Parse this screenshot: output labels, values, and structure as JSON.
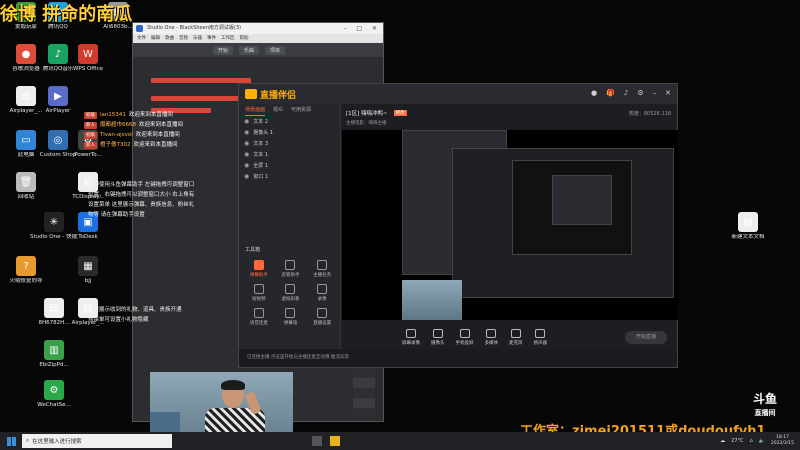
{
  "overlay": {
    "title": "徐博 拼命的南瓜"
  },
  "desktop_icons": [
    {
      "label": "爱毅玩家",
      "color": "#3a9b3a",
      "glyph": "◆"
    },
    {
      "label": "腾讯QQ",
      "color": "#1a9fe0",
      "glyph": "Q"
    },
    {
      "label": "Ali6803b...",
      "color": "#999999",
      "glyph": "▦"
    },
    {
      "label": "谷歌浏览器",
      "color": "#dd4b39",
      "glyph": "●"
    },
    {
      "label": "腾讯QQ音乐",
      "color": "#1aa260",
      "glyph": "♪"
    },
    {
      "label": "WPS Office",
      "color": "#d03a2f",
      "glyph": "W"
    },
    {
      "label": "Airplayer_...",
      "color": "#eeeeee",
      "glyph": "▤"
    },
    {
      "label": "AirPlayer",
      "color": "#5b6cc8",
      "glyph": "▶"
    },
    {
      "label": "此电脑",
      "color": "#2f86d6",
      "glyph": "▭"
    },
    {
      "label": "Custom Shop",
      "color": "#2f6fb0",
      "glyph": "◎"
    },
    {
      "label": "PowerTo...",
      "color": "#444444",
      "glyph": "⚙"
    },
    {
      "label": "回收站",
      "color": "#bbbbbb",
      "glyph": "🗑"
    },
    {
      "label": "TCDisplay...",
      "color": "#eeeeee",
      "glyph": "▤"
    },
    {
      "label": "Studio One - 快捷方式",
      "color": "#222222",
      "glyph": "✳"
    },
    {
      "label": "ToDesk",
      "color": "#1b6fe0",
      "glyph": "▣"
    },
    {
      "label": "火绒修复向导",
      "color": "#e89a2f",
      "glyph": "?"
    },
    {
      "label": "bjj",
      "color": "#2a2a2a",
      "glyph": "▦"
    },
    {
      "label": "8H6782H...",
      "color": "#eeeeee",
      "glyph": "▤"
    },
    {
      "label": "Airplayer_...",
      "color": "#eeeeee",
      "glyph": "▤"
    },
    {
      "label": "EbiZipPd...",
      "color": "#3aa04a",
      "glyph": "▥"
    },
    {
      "label": "WeChatSe...",
      "color": "#2aa84a",
      "glyph": "⚙"
    },
    {
      "label": "新建文本文档",
      "color": "#eeeeee",
      "glyph": "▤"
    }
  ],
  "studio_one": {
    "title": "Studio One - BlackSheen南方调试版(3)",
    "menu": [
      "文件",
      "编辑",
      "歌曲",
      "音频",
      "乐器",
      "事件",
      "工作区",
      "帮助"
    ],
    "toolbar": [
      "开始",
      "乐曲",
      "项目"
    ]
  },
  "chat": {
    "messages": [
      {
        "tag": "初级",
        "user": "lan15341",
        "text": "欢迎来到本直播间"
      },
      {
        "tag": "新人",
        "user": "魔都超市6668",
        "text": "欢迎来到本直播间"
      },
      {
        "tag": "初级",
        "user": "Tivan-ajsvol",
        "text": "欢迎来到本直播间"
      },
      {
        "tag": "新人",
        "user": "橙子傲7302",
        "text": "欢迎来到本直播间"
      }
    ],
    "help_1": "欢迎使用斗鱼弹幕助手 左键拖拽可调整窗口位置，右键拖拽可以调整窗口大小 右上角有设置菜单 这里展示弹幕、贵族信息、粉丝礼物等 请在弹幕助手设置",
    "help_2": "这里展示收到的礼物、道具、贵族开通 点菜单可设置小礼物隐藏"
  },
  "live": {
    "app_name": "直播伴侣",
    "tabs": [
      "场景画面",
      "观众",
      "可用资源"
    ],
    "sources": [
      "文本 2",
      "摄像头 1",
      "文本 3",
      "文本 1",
      "全屏 1",
      "窗口 1"
    ],
    "tools_title": "工具箱",
    "tools": [
      {
        "label": "弹幕助手",
        "hot": true
      },
      {
        "label": "房管助手",
        "hot": false
      },
      {
        "label": "主播任务",
        "hot": false
      },
      {
        "label": "短视频",
        "hot": false
      },
      {
        "label": "虚拟形象",
        "hot": false
      },
      {
        "label": "录像",
        "hot": false
      },
      {
        "label": "语音连麦",
        "hot": false
      },
      {
        "label": "弹幕墙",
        "hot": false
      },
      {
        "label": "直播设置",
        "hot": false
      }
    ],
    "room": {
      "title": "[1区] 嗨嗨冲鸭~",
      "badge": "修改",
      "sub": "主播电影：嗨嗨主播",
      "stats": "热度：8052K  118"
    },
    "bottom_controls": [
      "屏幕录像",
      "摄像头",
      "手机投屏",
      "多媒体",
      "麦克风",
      "扬声器"
    ],
    "start_label": "开始直播",
    "footer": "已连接主播    点这里开始与主播连麦互动哦    推流异常"
  },
  "stream_overlay": {
    "studio_tag": "工作室：zimei201511或doudoufyh1",
    "douyu_brand": "斗鱼",
    "douyu_sub": "直播间"
  },
  "taskbar": {
    "search_placeholder": "在这里输入进行搜索",
    "weather": "27°C",
    "time": "18:17",
    "date": "2022/3/15"
  }
}
